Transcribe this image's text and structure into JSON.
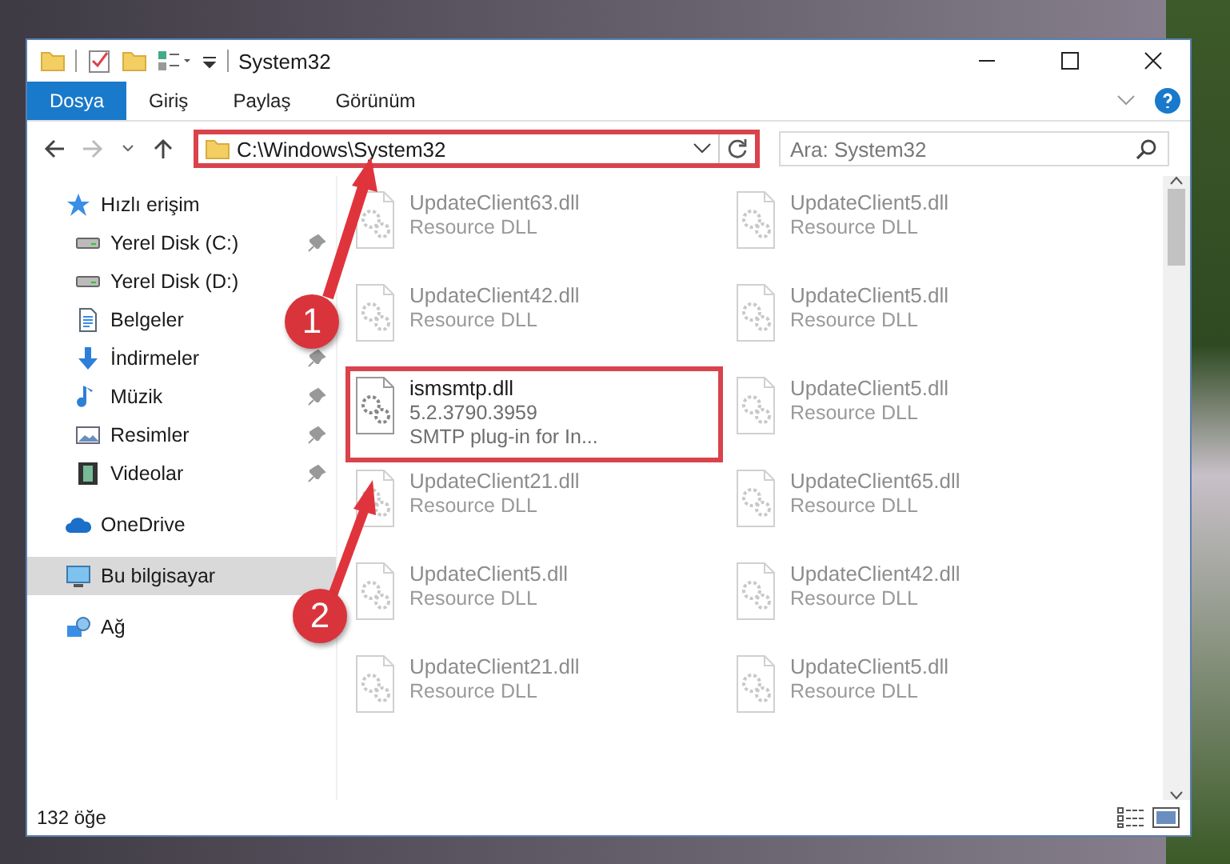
{
  "window": {
    "title": "System32"
  },
  "ribbon_tabs": [
    {
      "label": "Dosya",
      "selected": true
    },
    {
      "label": "Giriş",
      "selected": false
    },
    {
      "label": "Paylaş",
      "selected": false
    },
    {
      "label": "Görünüm",
      "selected": false
    }
  ],
  "address": {
    "path": "C:\\Windows\\System32",
    "highlighted": true
  },
  "search": {
    "placeholder": "Ara: System32"
  },
  "sidebar": {
    "items": [
      {
        "label": "Hızlı erişim",
        "kind": "star",
        "pinned": false,
        "selected": false,
        "children": [
          {
            "label": "Yerel Disk (C:)",
            "kind": "drive",
            "pinned": true,
            "selected": false
          },
          {
            "label": "Yerel Disk (D:)",
            "kind": "drive",
            "pinned": false,
            "selected": false
          },
          {
            "label": "Belgeler",
            "kind": "document",
            "pinned": false,
            "selected": false
          },
          {
            "label": "İndirmeler",
            "kind": "download",
            "pinned": true,
            "selected": false
          },
          {
            "label": "Müzik",
            "kind": "music",
            "pinned": true,
            "selected": false
          },
          {
            "label": "Resimler",
            "kind": "picture",
            "pinned": true,
            "selected": false
          },
          {
            "label": "Videolar",
            "kind": "video",
            "pinned": true,
            "selected": false
          }
        ]
      },
      {
        "label": "OneDrive",
        "kind": "cloud",
        "pinned": false,
        "selected": false
      },
      {
        "label": "Bu bilgisayar",
        "kind": "computer",
        "pinned": false,
        "selected": true
      },
      {
        "label": "Ağ",
        "kind": "network",
        "pinned": false,
        "selected": false
      }
    ]
  },
  "files": [
    {
      "name": "UpdateClient63.dll",
      "lines": [
        "Resource DLL"
      ],
      "dimmed": true,
      "highlighted": false
    },
    {
      "name": "UpdateClient5.dll",
      "lines": [
        "Resource DLL"
      ],
      "dimmed": true,
      "highlighted": false
    },
    {
      "name": "UpdateClient42.dll",
      "lines": [
        "Resource DLL"
      ],
      "dimmed": true,
      "highlighted": false
    },
    {
      "name": "UpdateClient5.dll",
      "lines": [
        "Resource DLL"
      ],
      "dimmed": true,
      "highlighted": false
    },
    {
      "name": "ismsmtp.dll",
      "lines": [
        "5.2.3790.3959",
        "SMTP plug-in for In..."
      ],
      "dimmed": false,
      "highlighted": true
    },
    {
      "name": "UpdateClient5.dll",
      "lines": [
        "Resource DLL"
      ],
      "dimmed": true,
      "highlighted": false
    },
    {
      "name": "UpdateClient21.dll",
      "lines": [
        "Resource DLL"
      ],
      "dimmed": true,
      "highlighted": false
    },
    {
      "name": "UpdateClient65.dll",
      "lines": [
        "Resource DLL"
      ],
      "dimmed": true,
      "highlighted": false
    },
    {
      "name": "UpdateClient5.dll",
      "lines": [
        "Resource DLL"
      ],
      "dimmed": true,
      "highlighted": false
    },
    {
      "name": "UpdateClient42.dll",
      "lines": [
        "Resource DLL"
      ],
      "dimmed": true,
      "highlighted": false
    },
    {
      "name": "UpdateClient21.dll",
      "lines": [
        "Resource DLL"
      ],
      "dimmed": true,
      "highlighted": false
    },
    {
      "name": "UpdateClient5.dll",
      "lines": [
        "Resource DLL"
      ],
      "dimmed": true,
      "highlighted": false
    }
  ],
  "status_bar": {
    "count": "132 öğe"
  },
  "callouts": [
    {
      "label": "1"
    },
    {
      "label": "2"
    }
  ]
}
